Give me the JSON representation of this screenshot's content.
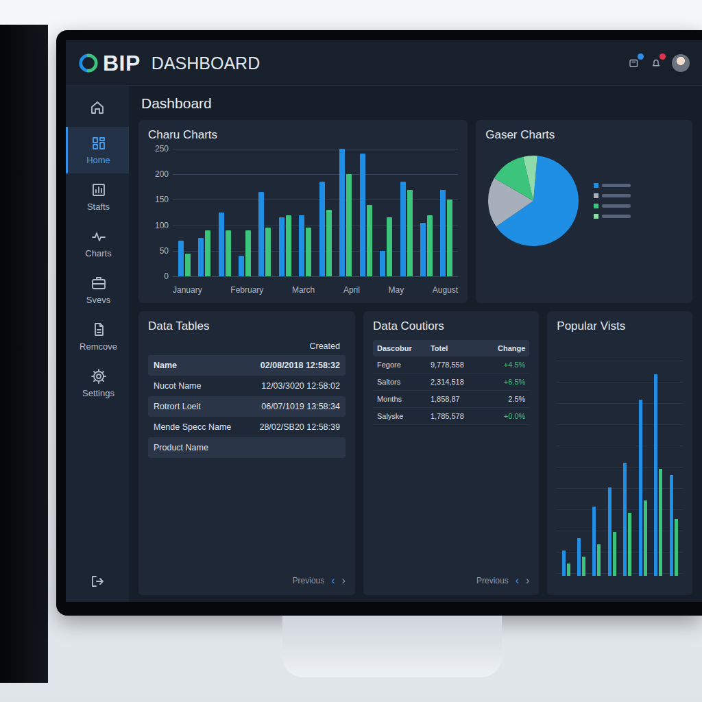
{
  "header": {
    "logo_text": "BIP",
    "title": "DASHBOARD"
  },
  "sidebar": {
    "items": [
      {
        "label": "Home",
        "selected": true
      },
      {
        "label": "Stafts",
        "selected": false
      },
      {
        "label": "Charts",
        "selected": false
      },
      {
        "label": "Svevs",
        "selected": false
      },
      {
        "label": "Remcove",
        "selected": false
      },
      {
        "label": "Settings",
        "selected": false
      }
    ]
  },
  "page_title": "Dashboard",
  "bar_chart": {
    "title": "Charu Charts",
    "y_ticks": [
      "250",
      "200",
      "150",
      "100",
      "50",
      "0"
    ],
    "x_labels": [
      "January",
      "February",
      "March",
      "April",
      "May",
      "August"
    ],
    "series": [
      {
        "color": "#1f8fe5",
        "values": [
          70,
          75,
          125,
          40,
          165,
          115,
          120,
          185,
          260,
          240,
          50,
          185,
          105,
          170
        ]
      },
      {
        "color": "#3cc47c",
        "values": [
          45,
          90,
          90,
          90,
          95,
          120,
          95,
          130,
          200,
          140,
          115,
          170,
          120,
          150
        ]
      }
    ]
  },
  "pie_chart": {
    "title": "Gaser Charts",
    "slices": [
      {
        "value": 64,
        "color": "#1f8fe5"
      },
      {
        "value": 18,
        "color": "#a7b0ba"
      },
      {
        "value": 13,
        "color": "#3cc47c"
      },
      {
        "value": 5,
        "color": "#8fdcaa"
      }
    ]
  },
  "data_table": {
    "title": "Data Tables",
    "header": "Created",
    "rows": [
      [
        "Name",
        "02/08/2018 12:58:32"
      ],
      [
        "Nucot Name",
        "12/03/3020 12:58:02"
      ],
      [
        "Rotrort Loeit",
        "06/07/1019 13:58:34"
      ],
      [
        "Mende Specc Name",
        "28/02/SB20 12:58:39"
      ],
      [
        "Product Name",
        ""
      ]
    ],
    "pager": {
      "previous": "Previous",
      "prev_icon": "‹",
      "next_icon": "›"
    }
  },
  "counters": {
    "title": "Data Coutiors",
    "columns": [
      "Dascobur",
      "Totel",
      "Change"
    ],
    "rows": [
      {
        "cells": [
          "Fegore",
          "9,778,558",
          "+4.5%"
        ],
        "color": "#3cc47c"
      },
      {
        "cells": [
          "Saltors",
          "2,314,518",
          "+6.5%"
        ],
        "color": "#3cc47c"
      },
      {
        "cells": [
          "Months",
          "1,858,87",
          "2.5%"
        ],
        "color": "#d7dee8"
      },
      {
        "cells": [
          "Salyske",
          "1,785,578",
          "+0.0%"
        ],
        "color": "#3cc47c"
      }
    ],
    "pager": {
      "previous": "Previous",
      "prev_icon": "‹",
      "next_icon": "›"
    }
  },
  "popular": {
    "title": "Popular Vists",
    "series": [
      {
        "color": "#1f8fe5",
        "values": [
          20,
          30,
          55,
          70,
          90,
          140,
          160,
          80
        ]
      },
      {
        "color": "#3cc47c",
        "values": [
          10,
          15,
          25,
          35,
          50,
          60,
          85,
          45
        ]
      }
    ]
  }
}
